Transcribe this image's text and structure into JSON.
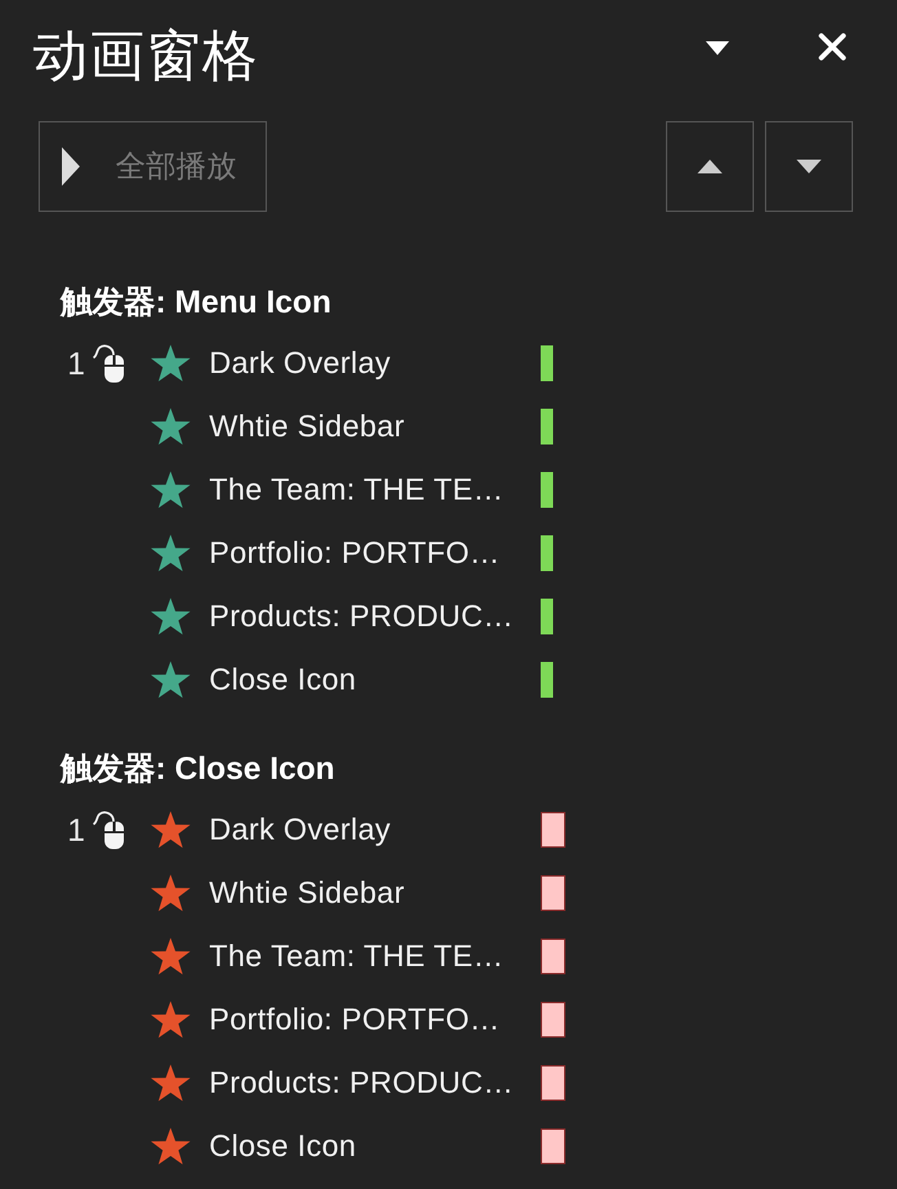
{
  "pane": {
    "title": "动画窗格"
  },
  "toolbar": {
    "play_all": {
      "label": "全部播放",
      "disabled": true
    }
  },
  "groups": [
    {
      "trigger": "触发器: Menu Icon",
      "items": [
        {
          "step": "1",
          "on_click": true,
          "kind": "entrance",
          "name": "Dark Overlay"
        },
        {
          "on_click": false,
          "kind": "entrance",
          "name": "Whtie Sidebar"
        },
        {
          "on_click": false,
          "kind": "entrance",
          "name": "The Team: THE TE…"
        },
        {
          "on_click": false,
          "kind": "entrance",
          "name": "Portfolio: PORTFO…"
        },
        {
          "on_click": false,
          "kind": "entrance",
          "name": "Products: PRODUC…"
        },
        {
          "on_click": false,
          "kind": "entrance",
          "name": "Close Icon"
        }
      ]
    },
    {
      "trigger": "触发器: Close Icon",
      "items": [
        {
          "step": "1",
          "on_click": true,
          "kind": "exit",
          "name": "Dark Overlay"
        },
        {
          "on_click": false,
          "kind": "exit",
          "name": "Whtie Sidebar"
        },
        {
          "on_click": false,
          "kind": "exit",
          "name": "The Team: THE TE…"
        },
        {
          "on_click": false,
          "kind": "exit",
          "name": "Portfolio: PORTFO…"
        },
        {
          "on_click": false,
          "kind": "exit",
          "name": "Products: PRODUC…"
        },
        {
          "on_click": false,
          "kind": "exit",
          "name": "Close Icon"
        }
      ]
    }
  ]
}
